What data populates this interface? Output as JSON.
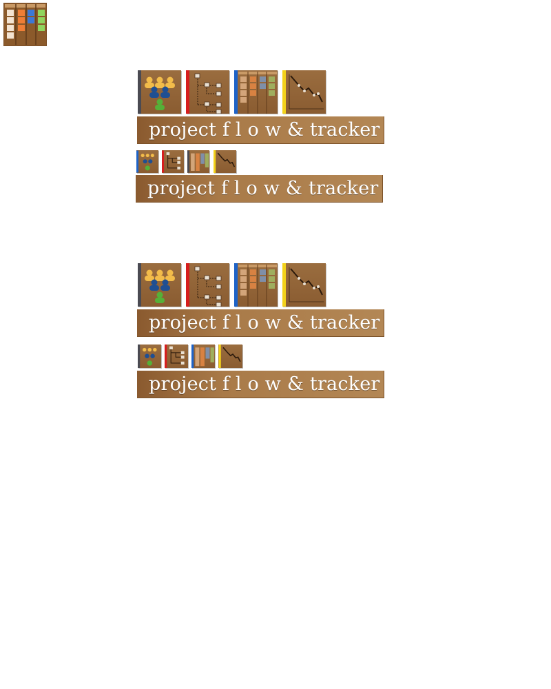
{
  "app_icon": {
    "name": "kanban-board-icon"
  },
  "groups": [
    {
      "banner_text": "project f l o w & tracker",
      "small_banner_text": "project f l o w & tracker",
      "icons": [
        "team-icon",
        "hierarchy-tree-icon",
        "kanban-board-icon",
        "burndown-chart-icon"
      ],
      "stripe_colors": [
        "#4a4a52",
        "#d61e1e",
        "#1e63c7",
        "#f3d21a"
      ]
    },
    {
      "banner_text": "project f l o w & tracker",
      "small_banner_text": "project f l o w & tracker",
      "icons": [
        "team-icon",
        "hierarchy-tree-icon",
        "kanban-board-icon",
        "burndown-chart-icon"
      ],
      "stripe_colors": [
        "#4a4a52",
        "#d61e1e",
        "#1e63c7",
        "#f3d21a"
      ]
    }
  ],
  "colors": {
    "wood": "#8f6235",
    "banner": "#a97a48",
    "person_yellow": "#f2bc4a",
    "person_blue": "#1f4f92",
    "person_green": "#55b038",
    "kanban_orange": "#e87a34",
    "kanban_blue": "#3f78d0",
    "kanban_green": "#8fd05a"
  }
}
